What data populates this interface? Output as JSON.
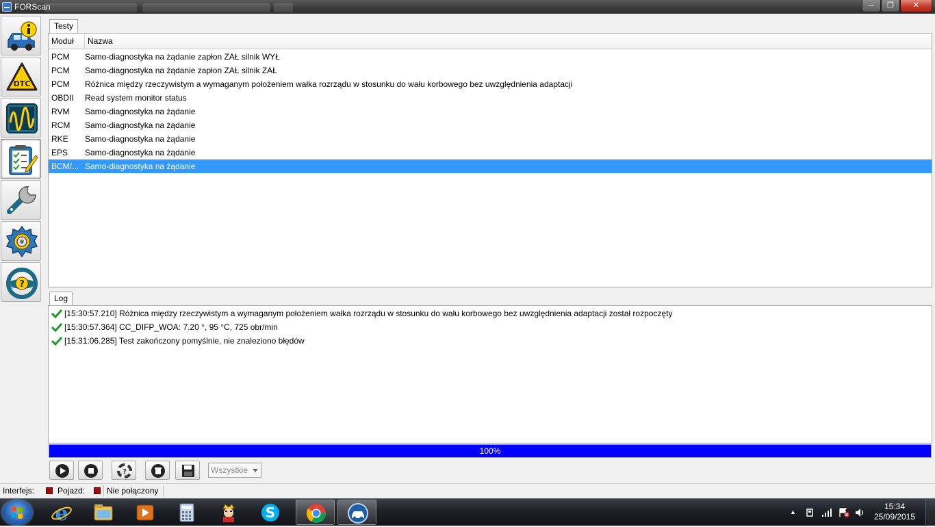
{
  "window": {
    "title": "FORScan",
    "minimize_glyph": "─",
    "maximize_glyph": "❐",
    "close_glyph": "✕"
  },
  "sidebar": {
    "items": [
      {
        "icon": "vehicle-info-icon"
      },
      {
        "icon": "dtc-warning-icon"
      },
      {
        "icon": "oscilloscope-icon"
      },
      {
        "icon": "checklist-icon",
        "active": true
      },
      {
        "icon": "wrench-icon"
      },
      {
        "icon": "gear-icon"
      },
      {
        "icon": "steering-wheel-help-icon"
      }
    ]
  },
  "tests": {
    "tab_label": "Testy",
    "columns": [
      "Moduł",
      "Nazwa"
    ],
    "rows": [
      {
        "module": "PCM",
        "name": "Samo-diagnostyka na żądanie zapłon ZAŁ silnik WYŁ"
      },
      {
        "module": "PCM",
        "name": "Samo-diagnostyka na żądanie zapłon ZAŁ silnik ZAŁ"
      },
      {
        "module": "PCM",
        "name": "Różnica między rzeczywistym a wymaganym położeniem wałka rozrządu w stosunku do wału korbowego bez uwzględnienia adaptacji"
      },
      {
        "module": "OBDII",
        "name": "Read system monitor status"
      },
      {
        "module": "RVM",
        "name": "Samo-diagnostyka na żądanie"
      },
      {
        "module": "RCM",
        "name": "Samo-diagnostyka na żądanie"
      },
      {
        "module": "RKE",
        "name": "Samo-diagnostyka na żądanie"
      },
      {
        "module": "EPS",
        "name": "Samo-diagnostyka na żądanie"
      },
      {
        "module": "BCM/...",
        "name": "Samo-diagnostyka na żądanie",
        "selected": true
      }
    ],
    "selection_color": "#3399ff"
  },
  "log": {
    "tab_label": "Log",
    "entries": [
      "[15:30:57.210] Różnica między rzeczywistym a wymaganym położeniem wałka rozrządu w stosunku do wału korbowego bez uwzględnienia adaptacji został rozpoczęty",
      "[15:30:57.364] CC_DIFP_WOA: 7.20 °, 95 °C, 725 obr/min",
      "[15:31:06.285] Test zakończony pomyślnie, nie znaleziono błędów"
    ],
    "entry_icon": "check-icon",
    "check_color": "#1a9a2a"
  },
  "progress": {
    "value": 1.0,
    "label": "100%",
    "fill_color": "#0000ff"
  },
  "controls": {
    "buttons": [
      "play-icon",
      "stop-icon",
      "lifebuoy-icon",
      "trash-icon",
      "floppy-disk-icon"
    ],
    "filter": {
      "value": "Wszystkie"
    }
  },
  "statusbar": {
    "interface_label": "Interfejs:",
    "vehicle_label": "Pojazd:",
    "connection_status": "Nie połączony",
    "led_color": "#9b1010"
  },
  "taskbar": {
    "apps": [
      {
        "icon": "internet-explorer-icon"
      },
      {
        "icon": "file-explorer-icon"
      },
      {
        "icon": "media-player-icon"
      },
      {
        "icon": "calculator-icon"
      },
      {
        "icon": "solitaire-king-icon"
      },
      {
        "icon": "skype-icon"
      },
      {
        "icon": "chrome-icon",
        "active": true
      },
      {
        "icon": "forscan-car-icon",
        "active": true
      }
    ],
    "clock_time": "15:34",
    "clock_date": "25/09/2015",
    "tray_chevron": "▲"
  }
}
